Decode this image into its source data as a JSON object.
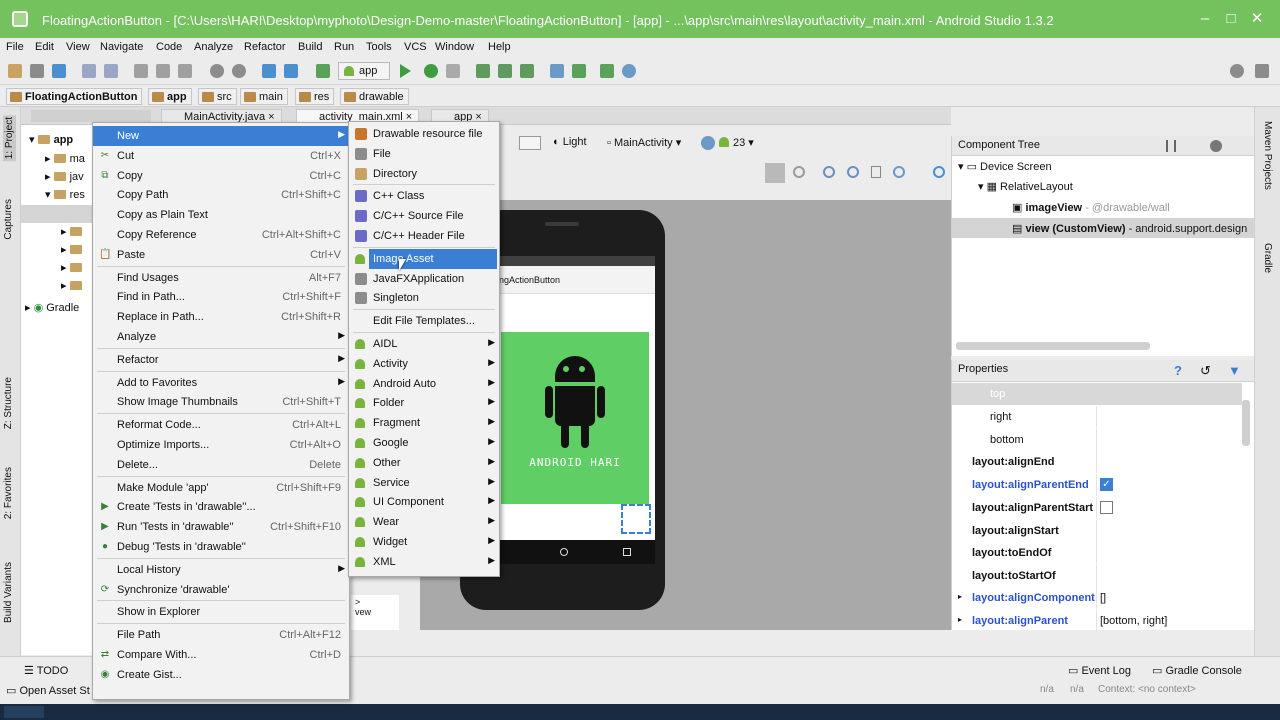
{
  "window": {
    "title": "FloatingActionButton - [C:\\Users\\HARI\\Desktop\\myphoto\\Design-Demo-master\\FloatingActionButton] - [app] - ...\\app\\src\\main\\res\\layout\\activity_main.xml - Android Studio 1.3.2",
    "controls": [
      "–",
      "□",
      "✕"
    ]
  },
  "menubar": [
    "File",
    "Edit",
    "View",
    "Navigate",
    "Code",
    "Analyze",
    "Refactor",
    "Build",
    "Run",
    "Tools",
    "VCS",
    "Window",
    "Help"
  ],
  "toolbar": {
    "run_config": "app"
  },
  "breadcrumbs": [
    "FloatingActionButton",
    "app",
    "src",
    "main",
    "res",
    "drawable"
  ],
  "editor_tabs": [
    "MainActivity.java",
    "activity_main.xml",
    "app"
  ],
  "project": {
    "root": "app",
    "items": [
      "ma",
      "jav",
      "res"
    ],
    "gradle": "Gradle"
  },
  "left_tools": [
    "1: Project",
    "Captures",
    "Z: Structure",
    "2: Favorites",
    "Build Variants"
  ],
  "right_tools": [
    "Maven Projects",
    "Gradle"
  ],
  "designer": {
    "theme": "Light",
    "activity": "MainActivity",
    "api": "23",
    "app_title": "ingActionButton",
    "logo_text": "ANDROID HARI"
  },
  "component_tree": {
    "title": "Component Tree",
    "nodes": [
      {
        "label": "Device Screen"
      },
      {
        "label": "RelativeLayout"
      },
      {
        "label": "imageView",
        "hint": "- @drawable/wall"
      },
      {
        "label": "view (CustomView)",
        "hint": "- android.support.design"
      }
    ]
  },
  "properties": {
    "title": "Properties",
    "rows": [
      {
        "k": "top",
        "v": ""
      },
      {
        "k": "right",
        "v": ""
      },
      {
        "k": "bottom",
        "v": ""
      },
      {
        "k": "layout:alignEnd",
        "v": ""
      },
      {
        "k": "layout:alignParentEnd",
        "v": "checked"
      },
      {
        "k": "layout:alignParentStart",
        "v": "unchecked"
      },
      {
        "k": "layout:alignStart",
        "v": ""
      },
      {
        "k": "layout:toEndOf",
        "v": ""
      },
      {
        "k": "layout:toStartOf",
        "v": ""
      },
      {
        "k": "layout:alignComponent",
        "v": "[]"
      },
      {
        "k": "layout:alignParent",
        "v": "[bottom, right]"
      }
    ]
  },
  "context_menu": [
    {
      "label": "New",
      "shortcut": "",
      "sub": true,
      "hl": true
    },
    {
      "label": "Cut",
      "shortcut": "Ctrl+X",
      "icon": "✂"
    },
    {
      "label": "Copy",
      "shortcut": "Ctrl+C",
      "icon": "⧉"
    },
    {
      "label": "Copy Path",
      "shortcut": "Ctrl+Shift+C"
    },
    {
      "label": "Copy as Plain Text",
      "shortcut": ""
    },
    {
      "label": "Copy Reference",
      "shortcut": "Ctrl+Alt+Shift+C"
    },
    {
      "label": "Paste",
      "shortcut": "Ctrl+V",
      "icon": "📋"
    },
    {
      "label": "Find Usages",
      "shortcut": "Alt+F7",
      "sep": true
    },
    {
      "label": "Find in Path...",
      "shortcut": "Ctrl+Shift+F"
    },
    {
      "label": "Replace in Path...",
      "shortcut": "Ctrl+Shift+R"
    },
    {
      "label": "Analyze",
      "shortcut": "",
      "sub": true
    },
    {
      "label": "Refactor",
      "shortcut": "",
      "sub": true,
      "sep": true
    },
    {
      "label": "Add to Favorites",
      "shortcut": "",
      "sub": true,
      "sep": true
    },
    {
      "label": "Show Image Thumbnails",
      "shortcut": "Ctrl+Shift+T"
    },
    {
      "label": "Reformat Code...",
      "shortcut": "Ctrl+Alt+L",
      "sep": true
    },
    {
      "label": "Optimize Imports...",
      "shortcut": "Ctrl+Alt+O"
    },
    {
      "label": "Delete...",
      "shortcut": "Delete"
    },
    {
      "label": "Make Module 'app'",
      "shortcut": "Ctrl+Shift+F9",
      "sep": true
    },
    {
      "label": "Create 'Tests in 'drawable''...",
      "shortcut": "",
      "icon": "▶"
    },
    {
      "label": "Run 'Tests in 'drawable''",
      "shortcut": "Ctrl+Shift+F10",
      "icon": "▶"
    },
    {
      "label": "Debug 'Tests in 'drawable''",
      "shortcut": "",
      "icon": "●"
    },
    {
      "label": "Local History",
      "shortcut": "",
      "sub": true,
      "sep": true
    },
    {
      "label": "Synchronize 'drawable'",
      "shortcut": "",
      "icon": "⟳"
    },
    {
      "label": "Show in Explorer",
      "shortcut": "",
      "sep": true
    },
    {
      "label": "File Path",
      "shortcut": "Ctrl+Alt+F12",
      "sep": true
    },
    {
      "label": "Compare With...",
      "shortcut": "Ctrl+D",
      "icon": "⇄"
    },
    {
      "label": "Create Gist...",
      "shortcut": "",
      "icon": "◉"
    }
  ],
  "new_menu": [
    {
      "label": "Drawable resource file",
      "icon": "res"
    },
    {
      "label": "File",
      "icon": "file"
    },
    {
      "label": "Directory",
      "icon": "dir"
    },
    {
      "label": "C++ Class",
      "icon": "cpp",
      "sep": true
    },
    {
      "label": "C/C++ Source File",
      "icon": "cpp"
    },
    {
      "label": "C/C++ Header File",
      "icon": "cpp"
    },
    {
      "label": "Image Asset",
      "icon": "android",
      "hl": true,
      "sep": true
    },
    {
      "label": "JavaFXApplication",
      "icon": "file"
    },
    {
      "label": "Singleton",
      "icon": "file"
    },
    {
      "label": "Edit File Templates...",
      "icon": "",
      "sep": true
    },
    {
      "label": "AIDL",
      "icon": "android",
      "sub": true,
      "sep": true
    },
    {
      "label": "Activity",
      "icon": "android",
      "sub": true
    },
    {
      "label": "Android Auto",
      "icon": "android",
      "sub": true
    },
    {
      "label": "Folder",
      "icon": "android",
      "sub": true
    },
    {
      "label": "Fragment",
      "icon": "android",
      "sub": true
    },
    {
      "label": "Google",
      "icon": "android",
      "sub": true
    },
    {
      "label": "Other",
      "icon": "android",
      "sub": true
    },
    {
      "label": "Service",
      "icon": "android",
      "sub": true
    },
    {
      "label": "UI Component",
      "icon": "android",
      "sub": true
    },
    {
      "label": "Wear",
      "icon": "android",
      "sub": true
    },
    {
      "label": "Widget",
      "icon": "android",
      "sub": true
    },
    {
      "label": "XML",
      "icon": "android",
      "sub": true
    }
  ],
  "statusbar": {
    "todo": "TODO",
    "status": "Open Asset St",
    "event_log": "Event Log",
    "gradle_console": "Gradle Console",
    "na1": "n/a",
    "na2": "n/a",
    "context": "Context: <no context>"
  },
  "colors": {
    "title_bg": "#73c25d",
    "highlight": "#3b7fd5",
    "link": "#2a52c9"
  }
}
